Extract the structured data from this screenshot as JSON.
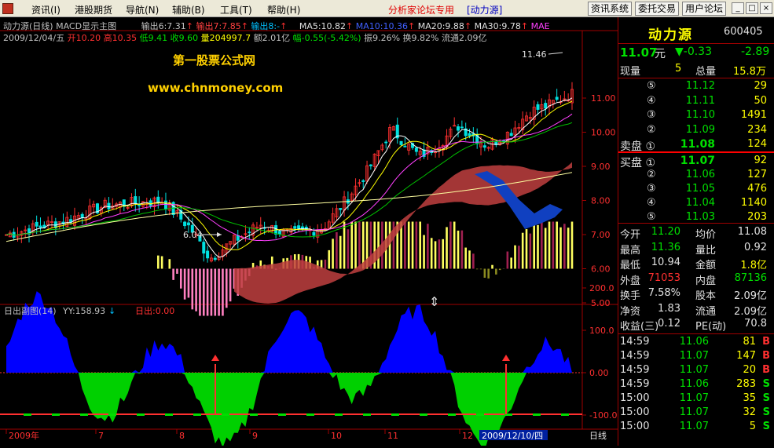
{
  "menubar": {
    "items": [
      "资讯(I)",
      "港股期货",
      "导航(N)",
      "辅助(B)",
      "工具(T)",
      "帮助(H)"
    ],
    "promo": "分析家论坛专用",
    "promo_name": "[动力源]",
    "buttons": [
      "资讯系统",
      "委托交易",
      "用户论坛"
    ],
    "win_buttons": [
      "_",
      "□",
      "×"
    ]
  },
  "header": {
    "title": "动力源(日线)",
    "template": "MACD显示主图",
    "out1": "输出6:7.31",
    "out2": "输出7:7.85",
    "out3": "输出8:-",
    "ma5": "MA5:10.82",
    "ma10": "MA10:10.36",
    "ma20": "MA20:9.88",
    "ma30": "MA30:9.78",
    "mae": "MAE",
    "date": "2009/12/04/五",
    "open": "开10.20",
    "high": "高10.35",
    "low": "低9.41",
    "close": "收9.60",
    "vol": "量204997.7",
    "amount": "额2.01亿",
    "change": "幅-0.55(-5.42%)",
    "amplitude": "振9.26%",
    "turnover": "换9.82%",
    "float": "流通2.09亿"
  },
  "watermark": {
    "line1": "第一股票公式网",
    "line2": "www.chnmoney.com"
  },
  "main_chart": {
    "high_label": "11.46",
    "low_label": "6.04",
    "y_ticks": [
      "11.00",
      "10.00",
      "9.00",
      "8.00",
      "7.00",
      "6.00",
      "5.00"
    ]
  },
  "sub_chart": {
    "title": "日出副图(14)",
    "yy": "YY:158.93",
    "yy_arrow": "↓",
    "out": "日出:0.00",
    "y_ticks": [
      "200.0",
      "100.0",
      "0.00",
      "-100.0"
    ]
  },
  "x_axis": {
    "labels": [
      "2009年",
      "7",
      "8",
      "9",
      "10",
      "11",
      "12"
    ],
    "cursor_date": "2009/12/10/四",
    "period": "日线"
  },
  "quote": {
    "name": "动力源",
    "code": "600405",
    "price": "11.07",
    "unit": "元",
    "change": "▼-0.33",
    "change_pct": "-2.89",
    "now_vol_label": "现量",
    "now_vol": "5",
    "total_vol_label": "总量",
    "total_vol": "15.8万",
    "sells": [
      {
        "lvl": "⑤",
        "price": "11.12",
        "vol": "29"
      },
      {
        "lvl": "④",
        "price": "11.11",
        "vol": "50"
      },
      {
        "lvl": "③",
        "price": "11.10",
        "vol": "1491"
      },
      {
        "lvl": "②",
        "price": "11.09",
        "vol": "234"
      },
      {
        "lvl": "卖盘 ①",
        "price": "11.08",
        "vol": "124"
      }
    ],
    "buys": [
      {
        "lvl": "买盘 ①",
        "price": "11.07",
        "vol": "92"
      },
      {
        "lvl": "②",
        "price": "11.06",
        "vol": "127"
      },
      {
        "lvl": "③",
        "price": "11.05",
        "vol": "476"
      },
      {
        "lvl": "④",
        "price": "11.04",
        "vol": "1140"
      },
      {
        "lvl": "⑤",
        "price": "11.03",
        "vol": "203"
      }
    ],
    "stats": [
      {
        "l1": "今开",
        "v1": "11.20",
        "l2": "均价",
        "v2": "11.08"
      },
      {
        "l1": "最高",
        "v1": "11.36",
        "l2": "量比",
        "v2": "0.92"
      },
      {
        "l1": "最低",
        "v1": "10.94",
        "l2": "金额",
        "v2": "1.8亿"
      },
      {
        "l1": "外盘",
        "v1": "71053",
        "l2": "内盘",
        "v2": "87136"
      },
      {
        "l1": "换手",
        "v1": "7.58%",
        "l2": "股本",
        "v2": "2.09亿"
      },
      {
        "l1": "净资",
        "v1": "1.83",
        "l2": "流通",
        "v2": "2.09亿"
      },
      {
        "l1": "收益(三)",
        "v1": "0.12",
        "l2": "PE(动)",
        "v2": "70.8"
      }
    ],
    "ticks": [
      {
        "t": "14:59",
        "p": "11.06",
        "v": "81",
        "s": "B"
      },
      {
        "t": "14:59",
        "p": "11.07",
        "v": "147",
        "s": "B"
      },
      {
        "t": "14:59",
        "p": "11.07",
        "v": "20",
        "s": "B"
      },
      {
        "t": "14:59",
        "p": "11.06",
        "v": "283",
        "s": "S"
      },
      {
        "t": "15:00",
        "p": "11.07",
        "v": "35",
        "s": "S"
      },
      {
        "t": "15:00",
        "p": "11.07",
        "v": "32",
        "s": "S"
      },
      {
        "t": "15:00",
        "p": "11.07",
        "v": "5",
        "s": "S"
      }
    ]
  },
  "colors": {
    "up": "#ff3030",
    "down": "#00e0e0",
    "ma5": "#ffffff",
    "ma10": "#ffff00",
    "ma20": "#ff40ff",
    "ma30": "#00c000",
    "blue_fill": "#0000ff",
    "green_fill": "#00d000",
    "red_band": "#c04040",
    "blue_band": "#1040c0",
    "yellow_bar": "#ffff60",
    "pink_bar": "#ff80c0",
    "maroon_bar": "#a02050",
    "olive_bar": "#8a8a20"
  }
}
